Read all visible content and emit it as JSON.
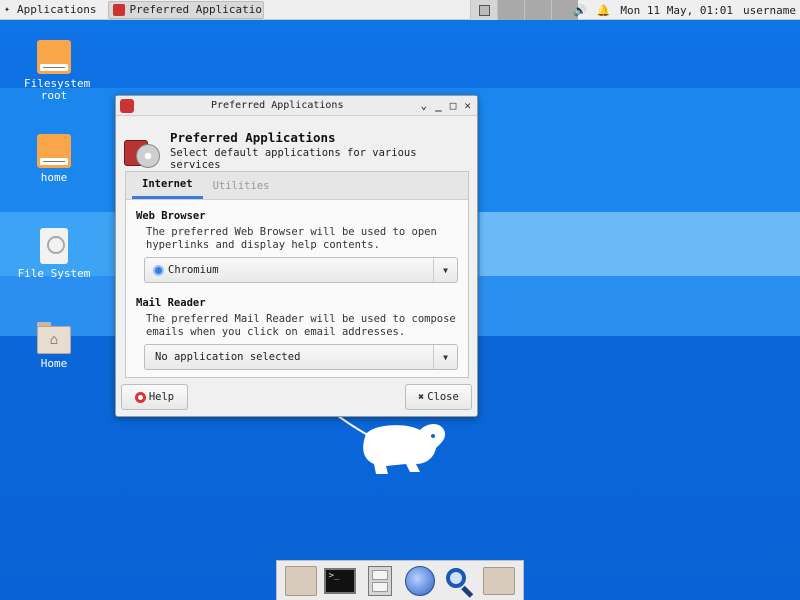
{
  "top_panel": {
    "applications_label": "Applications",
    "task_title": "Preferred Applicatio...",
    "clock": "Mon 11 May, 01:01",
    "username": "username",
    "icons": [
      "xfce-logo-icon",
      "volume-icon",
      "notification-bell-icon"
    ]
  },
  "desktop_icons": [
    {
      "label": "Filesystem root",
      "icon": "drive-icon"
    },
    {
      "label": "home",
      "icon": "drive-icon"
    },
    {
      "label": "File System",
      "icon": "hard-disk-icon"
    },
    {
      "label": "Home",
      "icon": "home-folder-icon"
    }
  ],
  "window": {
    "title": "Preferred Applications",
    "header_title": "Preferred Applications",
    "header_subtitle": "Select default applications for various services",
    "tabs": [
      {
        "label": "Internet",
        "active": true
      },
      {
        "label": "Utilities",
        "active": false
      }
    ],
    "web_browser": {
      "title": "Web Browser",
      "description": "The preferred Web Browser will be used to open hyperlinks and display help contents.",
      "selected": "Chromium"
    },
    "mail_reader": {
      "title": "Mail Reader",
      "description": "The preferred Mail Reader will be used to compose emails when you click on email addresses.",
      "selected": "No application selected"
    },
    "help_label": "Help",
    "close_label": "Close"
  },
  "dock": [
    "folder-icon",
    "terminal-icon",
    "file-manager-icon",
    "web-browser-icon",
    "search-icon",
    "folder-icon"
  ],
  "colors": {
    "desktop_blue": "#0b68da",
    "accent": "#3d7bd9"
  }
}
